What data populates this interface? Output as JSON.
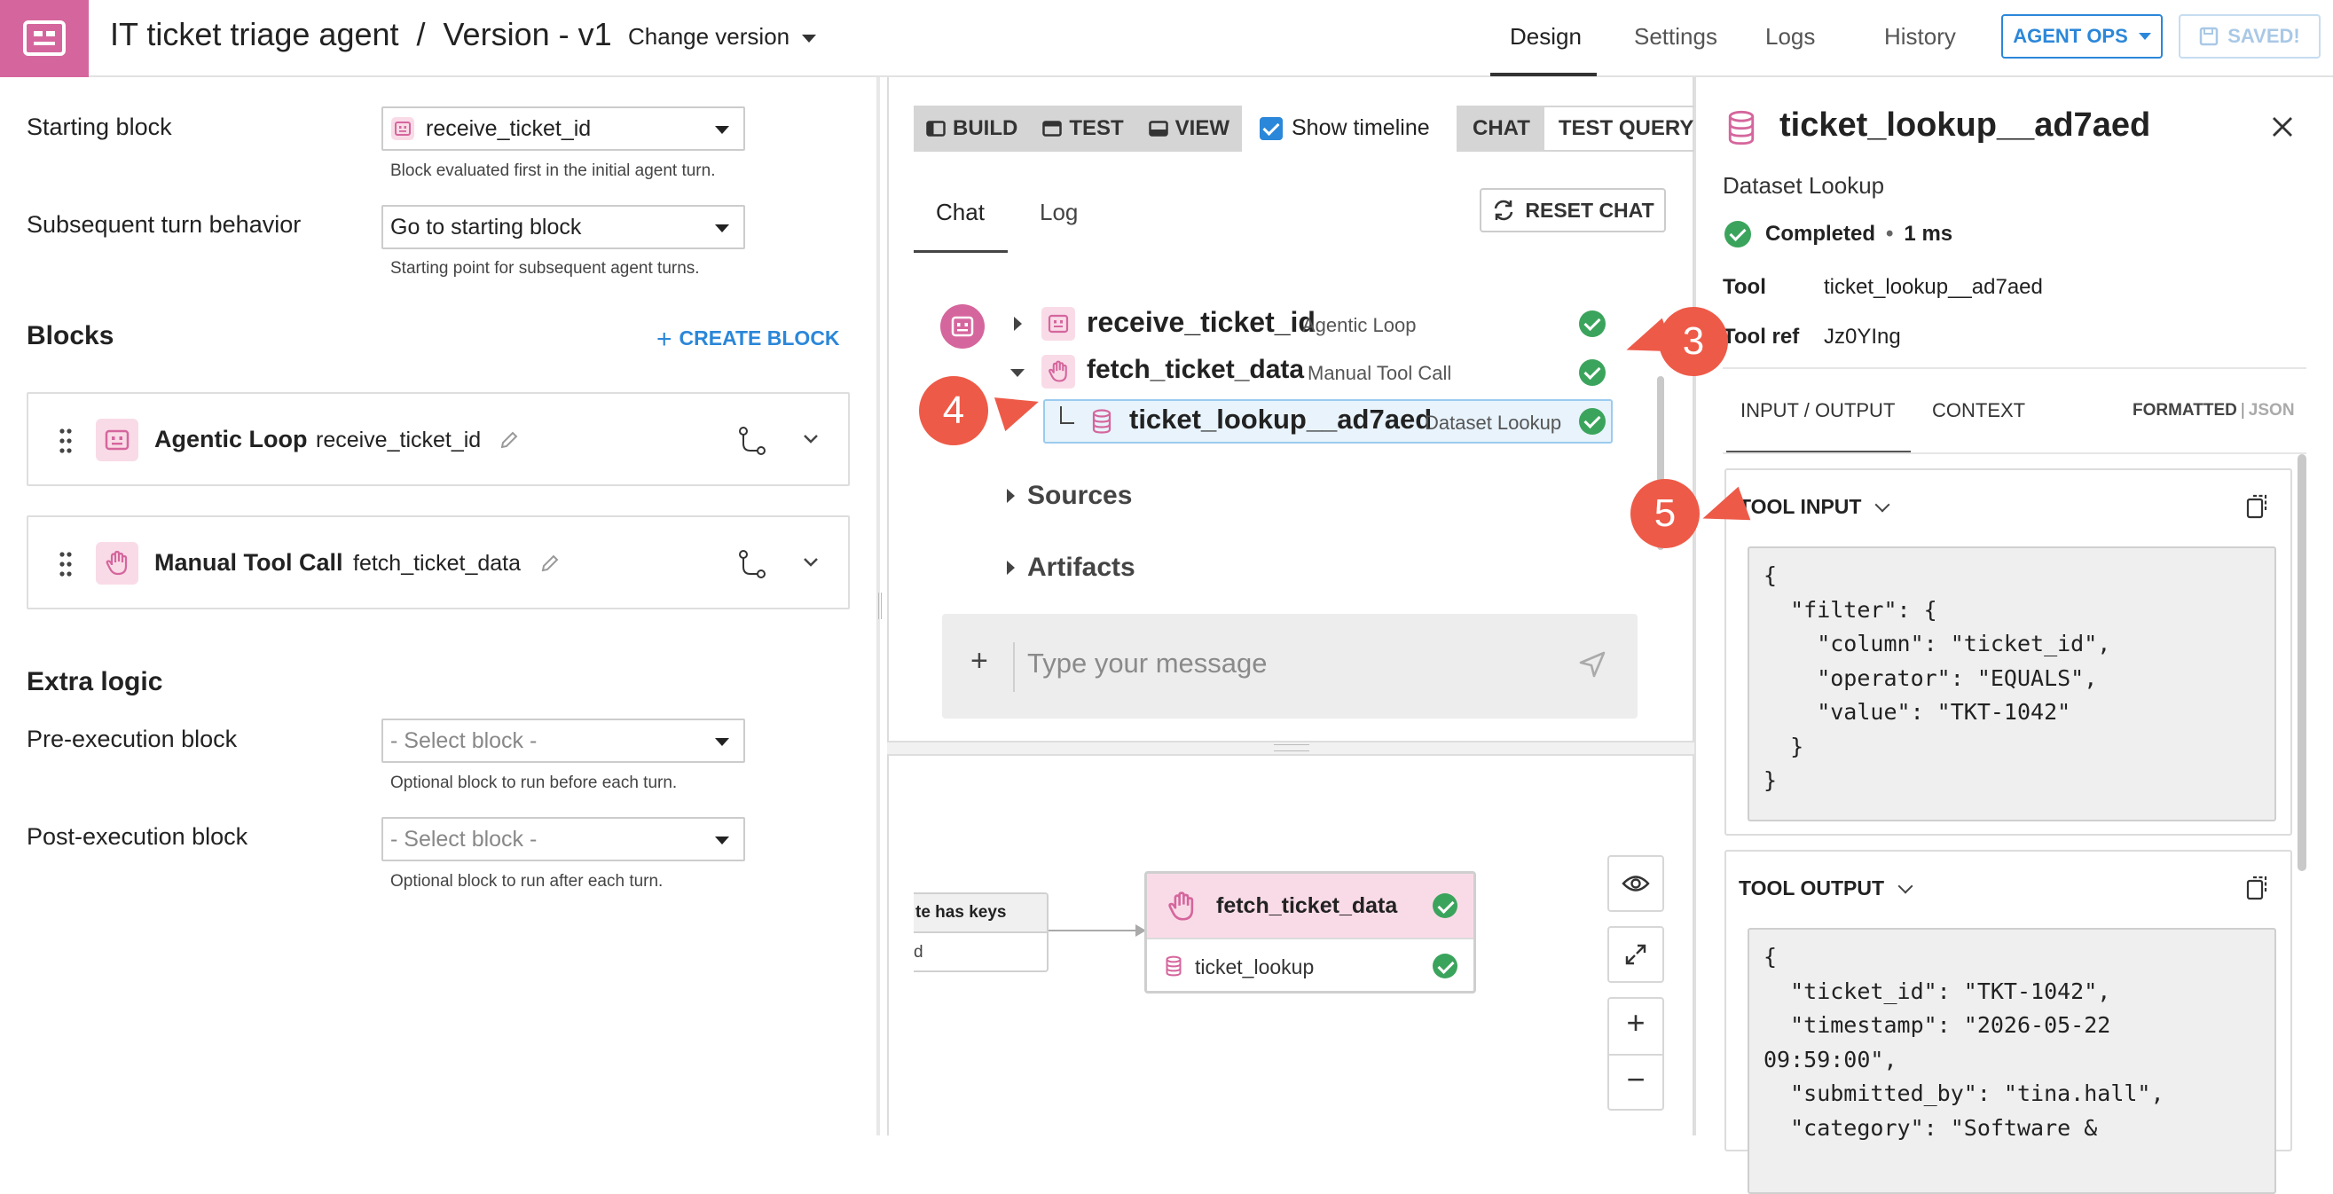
{
  "header": {
    "agent_name": "IT ticket triage agent",
    "separator": "/",
    "version": "Version - v1",
    "change_version": "Change version",
    "nav": {
      "design": "Design",
      "settings": "Settings",
      "logs": "Logs",
      "history": "History"
    },
    "agent_ops": "AGENT OPS",
    "saved": "SAVED!"
  },
  "left": {
    "starting_block_label": "Starting block",
    "starting_block_value": "receive_ticket_id",
    "starting_block_hint": "Block evaluated first in the initial agent turn.",
    "subsequent_label": "Subsequent turn behavior",
    "subsequent_value": "Go to starting block",
    "subsequent_hint": "Starting point for subsequent agent turns.",
    "blocks_title": "Blocks",
    "create_block": "CREATE BLOCK",
    "blocks": [
      {
        "type": "Agentic Loop",
        "name": "receive_ticket_id"
      },
      {
        "type": "Manual Tool Call",
        "name": "fetch_ticket_data"
      }
    ],
    "extra_logic_title": "Extra logic",
    "pre_label": "Pre-execution block",
    "pre_value": "- Select block -",
    "pre_hint": "Optional block to run before each turn.",
    "post_label": "Post-execution block",
    "post_value": "- Select block -",
    "post_hint": "Optional block to run after each turn."
  },
  "center": {
    "modes": {
      "build": "BUILD",
      "test": "TEST",
      "view": "VIEW"
    },
    "show_timeline": "Show timeline",
    "chat": "CHAT",
    "test_query": "TEST QUERY",
    "subtabs": {
      "chat": "Chat",
      "log": "Log"
    },
    "reset_chat": "RESET CHAT",
    "timeline": [
      {
        "name": "receive_ticket_id",
        "type": "Agentic Loop",
        "status": "completed"
      },
      {
        "name": "fetch_ticket_data",
        "type": "Manual Tool Call",
        "status": "completed"
      },
      {
        "name": "ticket_lookup__ad7aed",
        "type": "Dataset Lookup",
        "status": "completed"
      }
    ],
    "sources": "Sources",
    "artifacts": "Artifacts",
    "message_placeholder": "Type your message",
    "composer_plus": "+",
    "flow": {
      "prev_node_header": "te has keys",
      "prev_node_body": "d",
      "node_title": "fetch_ticket_data",
      "node_tool": "ticket_lookup"
    },
    "zoom_in": "+",
    "zoom_out": "−"
  },
  "right": {
    "title": "ticket_lookup__ad7aed",
    "subtitle": "Dataset Lookup",
    "status": "Completed",
    "status_sep": "•",
    "duration": "1 ms",
    "tool_label": "Tool",
    "tool_value": "ticket_lookup__ad7aed",
    "tool_ref_label": "Tool ref",
    "tool_ref_value": "Jz0YIng",
    "tabs": {
      "io": "INPUT / OUTPUT",
      "context": "CONTEXT"
    },
    "format_on": "FORMATTED",
    "format_sep": "|",
    "format_off": "JSON",
    "tool_input_label": "TOOL INPUT",
    "tool_input": "{\n  \"filter\": {\n    \"column\": \"ticket_id\",\n    \"operator\": \"EQUALS\",\n    \"value\": \"TKT-1042\"\n  }\n}",
    "tool_output_label": "TOOL OUTPUT",
    "tool_output": "{\n  \"ticket_id\": \"TKT-1042\",\n  \"timestamp\": \"2026-05-22\n09:59:00\",\n  \"submitted_by\": \"tina.hall\",\n  \"category\": \"Software &"
  },
  "callouts": [
    "3",
    "4",
    "5"
  ],
  "colors": {
    "brand_pink": "#d5669d",
    "pink_light": "#f9dbe7",
    "accent_blue": "#2b87d9",
    "success_green": "#3ba45c",
    "callout_red": "#ee5a48"
  }
}
